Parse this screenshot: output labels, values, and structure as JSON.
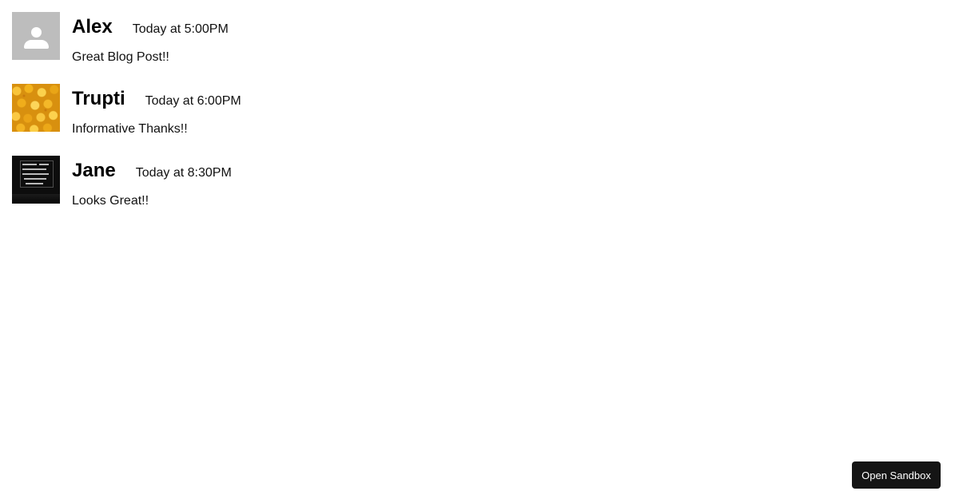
{
  "comments": [
    {
      "author": "Alex",
      "time": "Today at 5:00PM",
      "text": "Great Blog Post!!",
      "avatar_icon": "default-person-icon",
      "avatar_color": "#bdbdbd"
    },
    {
      "author": "Trupti",
      "time": "Today at 6:00PM",
      "text": "Informative Thanks!!",
      "avatar_icon": "rubber-ducks-photo",
      "avatar_color": "#e8a21a"
    },
    {
      "author": "Jane",
      "time": "Today at 8:30PM",
      "text": "Looks Great!!",
      "avatar_icon": "neon-sign-photo",
      "avatar_color": "#0d0d0d"
    }
  ],
  "sandbox_button": {
    "label": "Open Sandbox",
    "color": "#151515"
  }
}
